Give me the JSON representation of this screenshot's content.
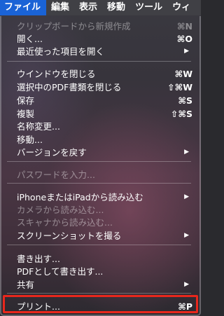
{
  "menubar": {
    "items": [
      {
        "label": "ファイル"
      },
      {
        "label": "編集"
      },
      {
        "label": "表示"
      },
      {
        "label": "移動"
      },
      {
        "label": "ツール"
      },
      {
        "label": "ウィ"
      }
    ]
  },
  "menu": {
    "items": [
      {
        "label": "クリップボードから新規作成",
        "shortcut": "⌘N",
        "enabled": false
      },
      {
        "label": "開く...",
        "shortcut": "⌘O",
        "enabled": true
      },
      {
        "label": "最近使った項目を開く",
        "submenu": true,
        "enabled": true
      },
      {
        "label": "ウインドウを閉じる",
        "shortcut": "⌘W",
        "enabled": true
      },
      {
        "label": "選択中のPDF書類を閉じる",
        "shortcut": "⇧⌘W",
        "enabled": true
      },
      {
        "label": "保存",
        "shortcut": "⌘S",
        "enabled": true
      },
      {
        "label": "複製",
        "shortcut": "⇧⌘S",
        "enabled": true
      },
      {
        "label": "名称変更...",
        "enabled": true
      },
      {
        "label": "移動...",
        "enabled": true
      },
      {
        "label": "バージョンを戻す",
        "submenu": true,
        "enabled": true
      },
      {
        "label": "パスワードを入力...",
        "enabled": false
      },
      {
        "label": "iPhoneまたはiPadから読み込む",
        "submenu": true,
        "enabled": true
      },
      {
        "label": "カメラから読み込む...",
        "enabled": false
      },
      {
        "label": "スキャナから読み込む...",
        "enabled": false
      },
      {
        "label": "スクリーンショットを撮る",
        "submenu": true,
        "enabled": true
      },
      {
        "label": "書き出す...",
        "enabled": true
      },
      {
        "label": "PDFとして書き出す...",
        "enabled": true
      },
      {
        "label": "共有",
        "submenu": true,
        "enabled": true
      },
      {
        "label": "プリント...",
        "shortcut": "⌘P",
        "enabled": true
      }
    ]
  },
  "icons": {
    "submenu_arrow": "submenu-arrow-icon"
  },
  "colors": {
    "menubar_active": "#1a63d6",
    "highlight_border": "#e8271c"
  }
}
